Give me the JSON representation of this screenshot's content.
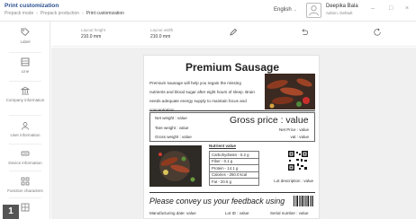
{
  "header": {
    "title": "Print customization",
    "breadcrumb": [
      "Prepack mode",
      "Prepack production",
      "Print customization"
    ],
    "language": "English",
    "user_name": "Deepika Bala",
    "user_role": "Admin, Default"
  },
  "sidebar": {
    "items": [
      {
        "label": "Label",
        "icon": "tag-icon"
      },
      {
        "label": "Line",
        "icon": "list-icon"
      },
      {
        "label": "Company information",
        "icon": "building-icon"
      },
      {
        "label": "User information",
        "icon": "user-icon"
      },
      {
        "label": "Device information",
        "icon": "device-icon"
      },
      {
        "label": "Function characters",
        "icon": "grid-icon"
      }
    ],
    "badge": "1"
  },
  "toolbar": {
    "height_label": "Layout height",
    "height_value": "210.0 mm",
    "width_label": "Layout width",
    "width_value": "210.0 mm"
  },
  "label": {
    "title": "Premium Sausage",
    "description": "Premium sausage will help you regain the missing nutrients and blood sugar after eight hours of sleep. Brain needs adequate energy supply to maintain focus and concentration.",
    "net_weight": "Net weight : value",
    "tare_weight": "Tare weight : value",
    "gross_weight": "Gross weight : value",
    "gross_price": "Gross price : value",
    "net_price": "Net Price : value",
    "vat": "vat : value",
    "nutrient_title": "Nutrient value",
    "nutrients": [
      "Carbohydrates - 5.2 g",
      "Fiber - 0.1 g",
      "Protein - 14.1 g",
      "Calories - 250.0 kcal",
      "Fat - 20.5 g"
    ],
    "lot_description": "Lot description : value",
    "feedback": "Please convey us your feedback using",
    "manufacturing_date": "Manufacturing date: value",
    "lot_id": "Lot ID : value",
    "serial_number": "Serial number : value"
  },
  "colors": {
    "title_blue": "#2a4f8f",
    "canvas_bg": "#f0f0f0"
  }
}
